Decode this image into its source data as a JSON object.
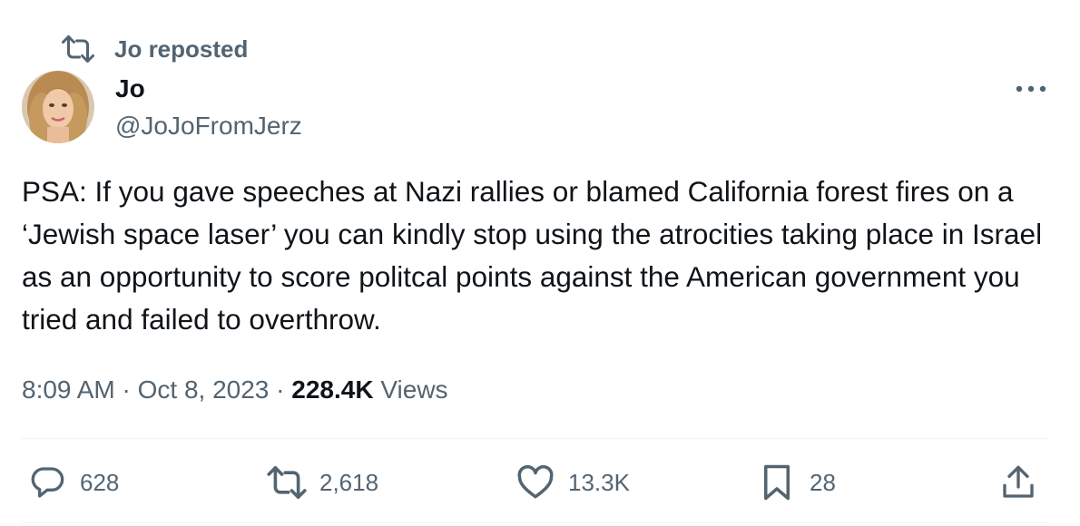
{
  "repost": {
    "label": "Jo reposted",
    "icon": "repost-icon"
  },
  "author": {
    "display_name": "Jo",
    "handle": "@JoJoFromJerz",
    "avatar": "profile-photo"
  },
  "more_icon": "more-options-icon",
  "tweet": {
    "text": "PSA: If you gave speeches at Nazi rallies or blamed California forest fires on a ‘Jewish space laser’ you can kindly stop using the atrocities taking place in Israel as an opportunity to score politcal points against the American government you tried and failed to overthrow."
  },
  "meta": {
    "time": "8:09 AM",
    "separator": "·",
    "date": "Oct 8, 2023",
    "views_count": "228.4K",
    "views_label": "Views"
  },
  "actions": {
    "replies": "628",
    "reposts": "2,618",
    "likes": "13.3K",
    "bookmarks": "28"
  },
  "colors": {
    "text_primary": "#0f1419",
    "text_secondary": "#536471",
    "divider": "#eff3f4"
  }
}
